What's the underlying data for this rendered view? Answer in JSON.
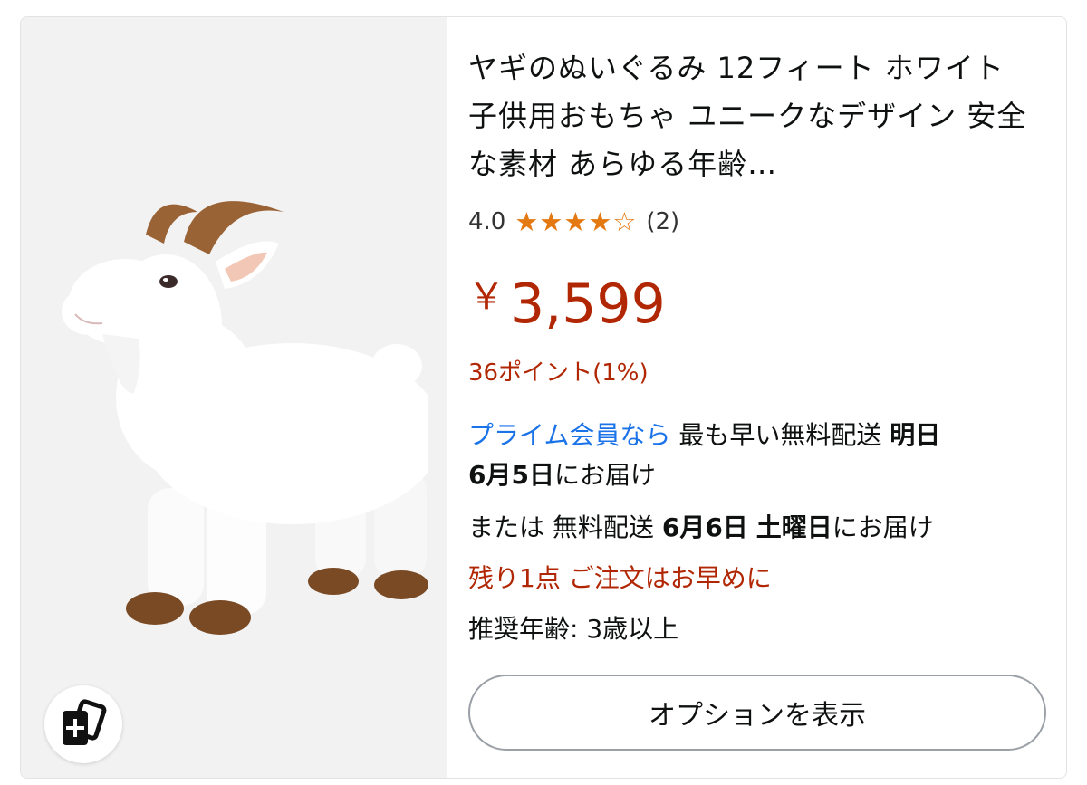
{
  "product": {
    "title": "ヤギのぬいぐるみ 12フィート ホワイト 子供用おもちゃ ユニークなデザイン 安全な素材 あらゆる年齢…",
    "rating": "4.0",
    "rating_value": 4.0,
    "rating_max": 5,
    "review_count": "(2)",
    "currency": "￥",
    "price": "3,599",
    "points": "36ポイント(1%)",
    "image_icon": "goat-plush-image"
  },
  "delivery": {
    "prime_link": "プライム会員なら",
    "fastest_label": "最も早い無料配送",
    "fastest_day": "明日",
    "fastest_date": "6月5日",
    "deliver_suffix": "にお届け",
    "or_label": "または",
    "free_label": "無料配送",
    "free_date": "6月6日",
    "free_weekday": "土曜日",
    "free_suffix": "にお届け"
  },
  "stock": {
    "left": "残り1点",
    "hurry": "ご注文はお早めに"
  },
  "age": {
    "label": "推奨年齢:",
    "value": "3歳以上"
  },
  "actions": {
    "options_button": "オプションを表示",
    "compare_icon": "add-to-compare-icon"
  },
  "colors": {
    "price": "#b12704",
    "prime": "#1a73e8",
    "star": "#e47911"
  }
}
